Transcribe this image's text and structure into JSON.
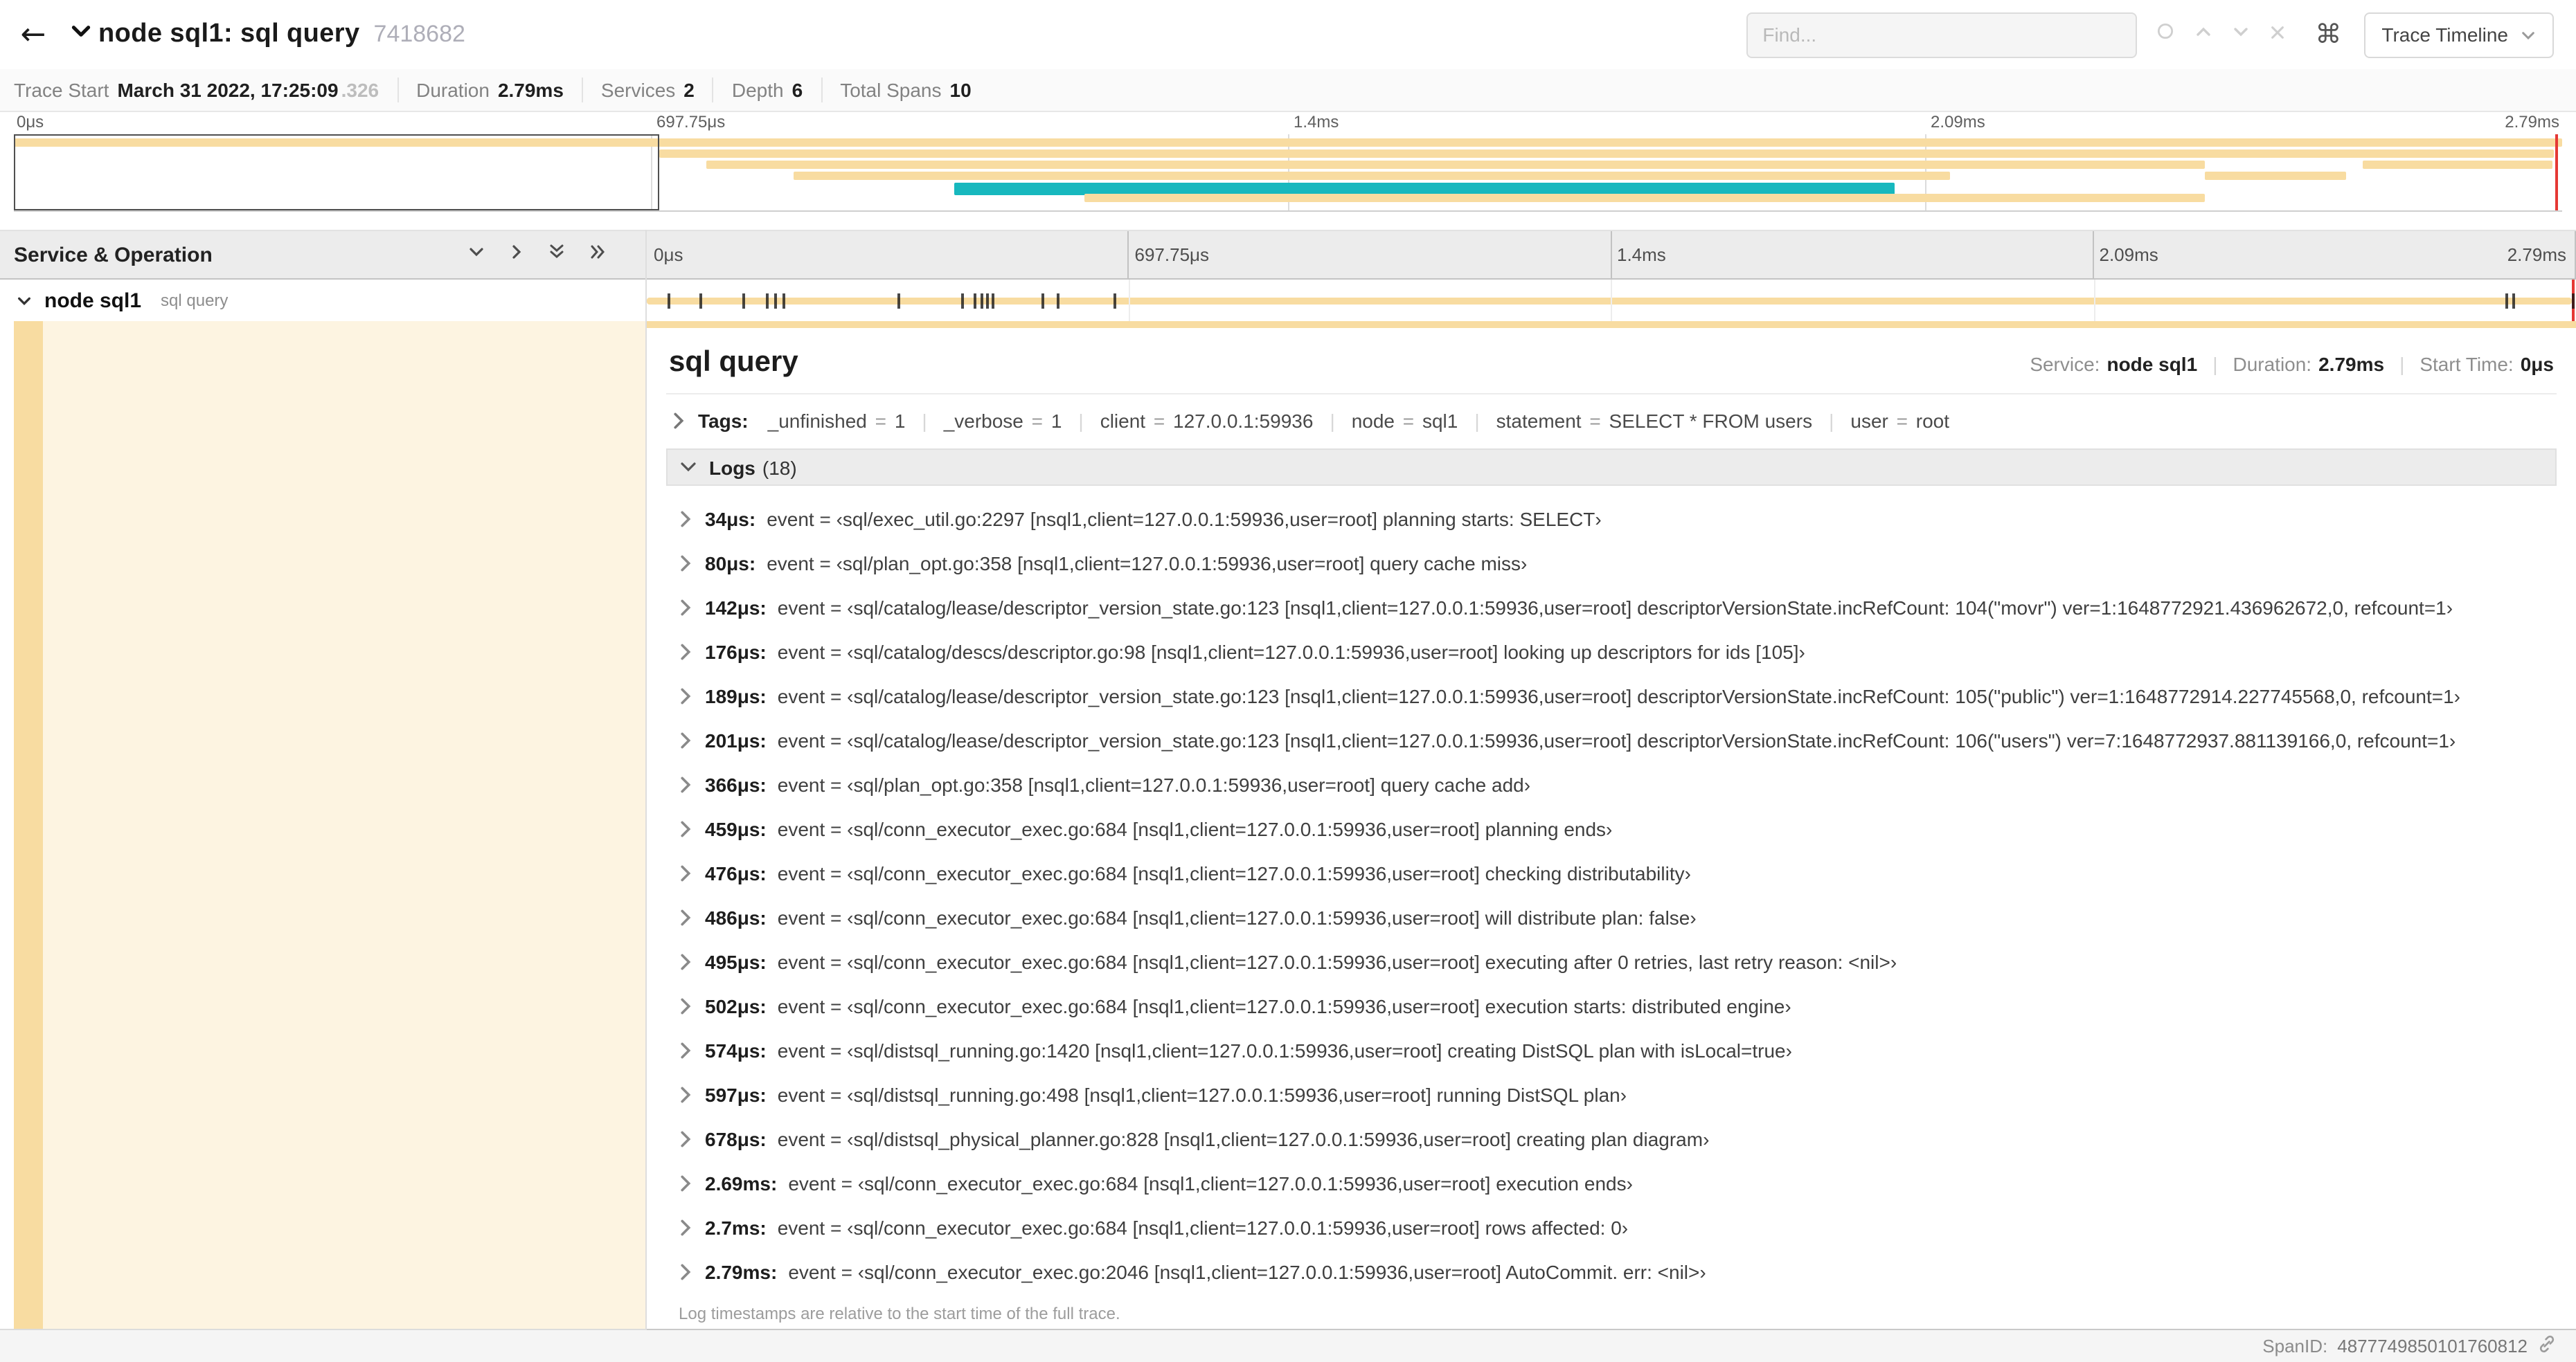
{
  "header": {
    "back_glyph": "←",
    "title": "node sql1: sql query",
    "trace_id": "7418682",
    "find_placeholder": "Find...",
    "shortcut_key": "⌘",
    "view_selector_label": "Trace Timeline"
  },
  "meta": {
    "items": [
      {
        "label": "Trace Start",
        "value": "March 31 2022, 17:25:09",
        "suffix": ".326"
      },
      {
        "label": "Duration",
        "value": "2.79ms",
        "suffix": ""
      },
      {
        "label": "Services",
        "value": "2",
        "suffix": ""
      },
      {
        "label": "Depth",
        "value": "6",
        "suffix": ""
      },
      {
        "label": "Total Spans",
        "value": "10",
        "suffix": ""
      }
    ]
  },
  "timeline": {
    "ticks": [
      "0μs",
      "697.75μs",
      "1.4ms",
      "2.09ms",
      "2.79ms"
    ],
    "left_header": "Service & Operation",
    "row": {
      "service": "node sql1",
      "operation": "sql query"
    },
    "minimap": {
      "colors": {
        "tan": "#F8DCA1",
        "teal": "#17B8BE",
        "cursor": "#E53935"
      },
      "viewport_pct": [
        0,
        25.3
      ],
      "bars": [
        {
          "row": 0,
          "left": 0,
          "width": 100,
          "color": "tan"
        },
        {
          "row": 1,
          "left": 25.3,
          "width": 74.4,
          "color": "tan"
        },
        {
          "row": 2,
          "left": 27.2,
          "width": 58.8,
          "color": "tan"
        },
        {
          "row": 2,
          "left": 92.2,
          "width": 7.4,
          "color": "tan"
        },
        {
          "row": 3,
          "left": 30.6,
          "width": 45.4,
          "color": "tan"
        },
        {
          "row": 3,
          "left": 86.0,
          "width": 5.5,
          "color": "tan"
        },
        {
          "row": 4,
          "left": 36.9,
          "width": 36.9,
          "color": "teal"
        },
        {
          "row": 5,
          "left": 42.0,
          "width": 44.0,
          "color": "tan"
        }
      ]
    }
  },
  "detail": {
    "title": "sql query",
    "overview": [
      {
        "label": "Service:",
        "value": "node sql1"
      },
      {
        "label": "Duration:",
        "value": "2.79ms"
      },
      {
        "label": "Start Time:",
        "value": "0μs"
      }
    ],
    "tags": {
      "label": "Tags:",
      "items": [
        {
          "key": "_unfinished",
          "value": "1"
        },
        {
          "key": "_verbose",
          "value": "1"
        },
        {
          "key": "client",
          "value": "127.0.0.1:59936"
        },
        {
          "key": "node",
          "value": "sql1"
        },
        {
          "key": "statement",
          "value": "SELECT * FROM users"
        },
        {
          "key": "user",
          "value": "root"
        }
      ]
    },
    "logs": {
      "label": "Logs",
      "count": "(18)",
      "entries": [
        {
          "time": "34μs:",
          "pct": 1.22,
          "text": "event = ‹sql/exec_util.go:2297 [nsql1,client=127.0.0.1:59936,user=root] planning starts: SELECT›"
        },
        {
          "time": "80μs:",
          "pct": 2.87,
          "text": "event = ‹sql/plan_opt.go:358 [nsql1,client=127.0.0.1:59936,user=root] query cache miss›"
        },
        {
          "time": "142μs:",
          "pct": 5.09,
          "text": "event = ‹sql/catalog/lease/descriptor_version_state.go:123 [nsql1,client=127.0.0.1:59936,user=root] descriptorVersionState.incRefCount: 104(\"movr\") ver=1:1648772921.436962672,0, refcount=1›"
        },
        {
          "time": "176μs:",
          "pct": 6.31,
          "text": "event = ‹sql/catalog/descs/descriptor.go:98 [nsql1,client=127.0.0.1:59936,user=root] looking up descriptors for ids [105]›"
        },
        {
          "time": "189μs:",
          "pct": 6.77,
          "text": "event = ‹sql/catalog/lease/descriptor_version_state.go:123 [nsql1,client=127.0.0.1:59936,user=root] descriptorVersionState.incRefCount: 105(\"public\") ver=1:1648772914.227745568,0, refcount=1›"
        },
        {
          "time": "201μs:",
          "pct": 7.2,
          "text": "event = ‹sql/catalog/lease/descriptor_version_state.go:123 [nsql1,client=127.0.0.1:59936,user=root] descriptorVersionState.incRefCount: 106(\"users\") ver=7:1648772937.881139166,0, refcount=1›"
        },
        {
          "time": "366μs:",
          "pct": 13.12,
          "text": "event = ‹sql/plan_opt.go:358 [nsql1,client=127.0.0.1:59936,user=root] query cache add›"
        },
        {
          "time": "459μs:",
          "pct": 16.45,
          "text": "event = ‹sql/conn_executor_exec.go:684 [nsql1,client=127.0.0.1:59936,user=root] planning ends›"
        },
        {
          "time": "476μs:",
          "pct": 17.06,
          "text": "event = ‹sql/conn_executor_exec.go:684 [nsql1,client=127.0.0.1:59936,user=root] checking distributability›"
        },
        {
          "time": "486μs:",
          "pct": 17.42,
          "text": "event = ‹sql/conn_executor_exec.go:684 [nsql1,client=127.0.0.1:59936,user=root] will distribute plan: false›"
        },
        {
          "time": "495μs:",
          "pct": 17.74,
          "text": "event = ‹sql/conn_executor_exec.go:684 [nsql1,client=127.0.0.1:59936,user=root] executing after 0 retries, last retry reason: <nil>›"
        },
        {
          "time": "502μs:",
          "pct": 17.99,
          "text": "event = ‹sql/conn_executor_exec.go:684 [nsql1,client=127.0.0.1:59936,user=root] execution starts: distributed engine›"
        },
        {
          "time": "574μs:",
          "pct": 20.57,
          "text": "event = ‹sql/distsql_running.go:1420 [nsql1,client=127.0.0.1:59936,user=root] creating DistSQL plan with isLocal=true›"
        },
        {
          "time": "597μs:",
          "pct": 21.4,
          "text": "event = ‹sql/distsql_running.go:498 [nsql1,client=127.0.0.1:59936,user=root] running DistSQL plan›"
        },
        {
          "time": "678μs:",
          "pct": 24.3,
          "text": "event = ‹sql/distsql_physical_planner.go:828 [nsql1,client=127.0.0.1:59936,user=root] creating plan diagram›"
        },
        {
          "time": "2.69ms:",
          "pct": 96.42,
          "text": "event = ‹sql/conn_executor_exec.go:684 [nsql1,client=127.0.0.1:59936,user=root] execution ends›"
        },
        {
          "time": "2.7ms:",
          "pct": 96.77,
          "text": "event = ‹sql/conn_executor_exec.go:684 [nsql1,client=127.0.0.1:59936,user=root] rows affected: 0›"
        },
        {
          "time": "2.79ms:",
          "pct": 99.85,
          "text": "event = ‹sql/conn_executor_exec.go:2046 [nsql1,client=127.0.0.1:59936,user=root] AutoCommit. err: <nil>›"
        }
      ],
      "footnote": "Log timestamps are relative to the start time of the full trace."
    },
    "span_id_label": "SpanID:",
    "span_id": "4877749850101760812"
  }
}
